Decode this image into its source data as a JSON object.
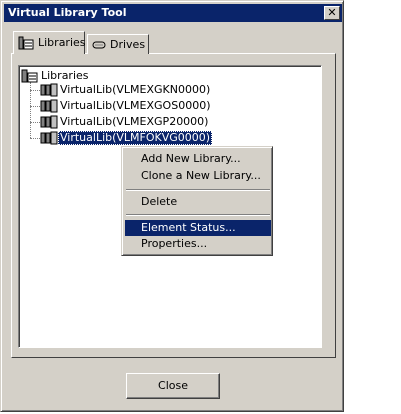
{
  "window": {
    "title": "Virtual Library Tool"
  },
  "tabs": [
    {
      "label": "Libraries",
      "icon": "libraries-icon",
      "active": true
    },
    {
      "label": "Drives",
      "icon": "drive-icon",
      "active": false
    }
  ],
  "tree": {
    "root": {
      "label": "Libraries",
      "icon": "libraries-icon"
    },
    "children": [
      {
        "label": "VirtualLib(VLMEXGKN0000)",
        "icon": "tape-library-icon"
      },
      {
        "label": "VirtualLib(VLMEXGOS0000)",
        "icon": "tape-library-icon"
      },
      {
        "label": "VirtualLib(VLMEXGP20000)",
        "icon": "tape-library-icon"
      },
      {
        "label": "VirtualLib(VLMFOKVG0000)",
        "icon": "tape-library-icon",
        "selected": true
      }
    ]
  },
  "context_menu": {
    "items": [
      {
        "label": "Add New Library..."
      },
      {
        "label": "Clone a New Library..."
      },
      {
        "label": "Delete"
      },
      {
        "label": "Element Status...",
        "highlighted": true
      },
      {
        "label": "Properties..."
      }
    ]
  },
  "footer": {
    "close_label": "Close"
  },
  "colors": {
    "titlebar": "#0a246a",
    "face": "#d4d0c8",
    "selection": "#0a246a"
  }
}
